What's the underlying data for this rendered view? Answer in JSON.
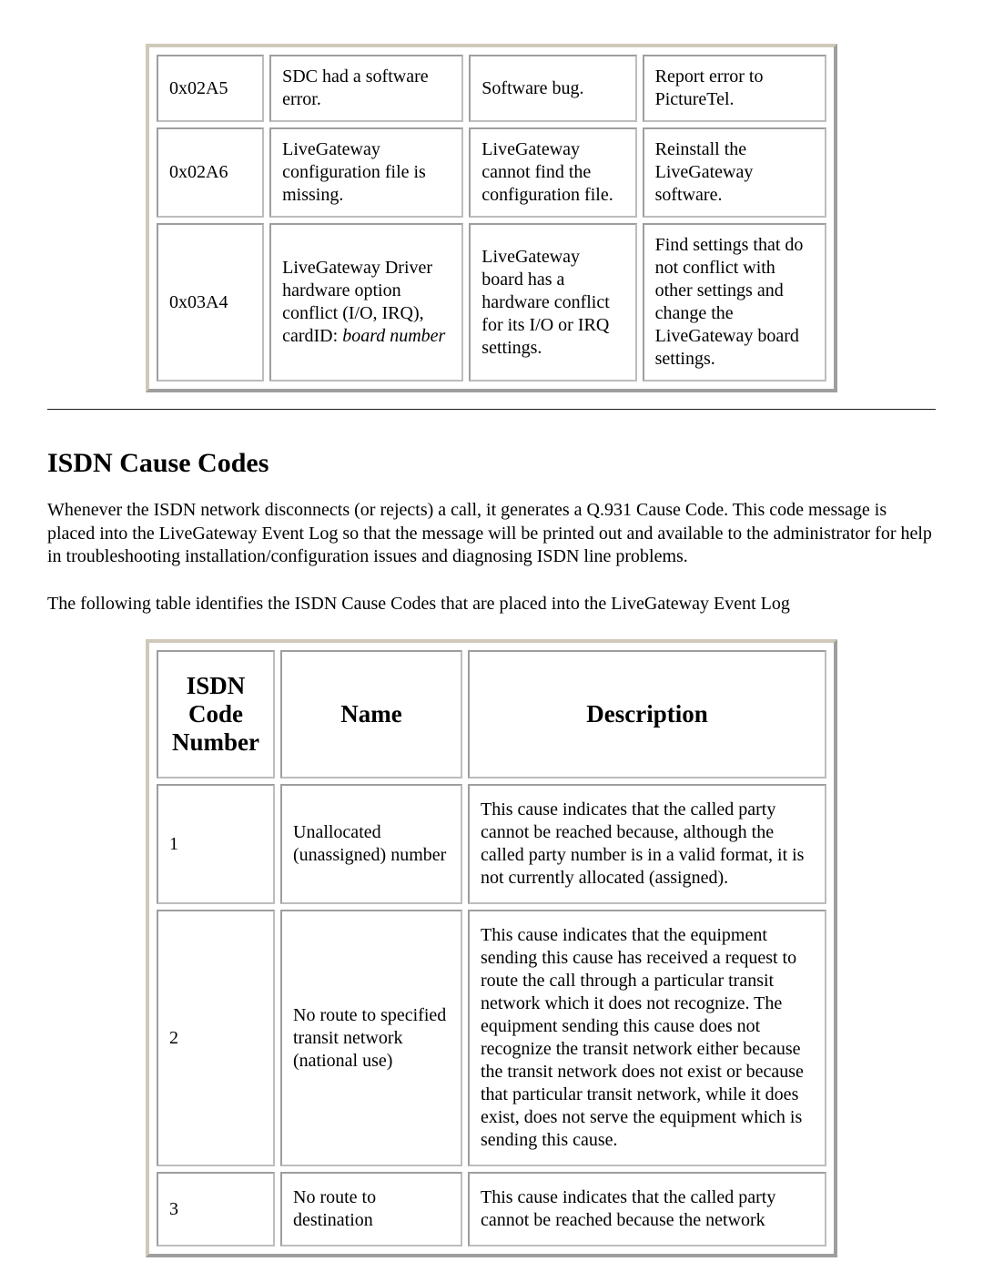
{
  "error_table": {
    "rows": [
      {
        "code": "0x02A5",
        "message": "SDC had a software error.",
        "cause": "Software bug.",
        "action": "Report error to PictureTel."
      },
      {
        "code": "0x02A6",
        "message": "LiveGateway configuration file is missing.",
        "cause": "LiveGateway cannot find the configuration file.",
        "action": "Reinstall the LiveGateway software."
      },
      {
        "code": "0x03A4",
        "message_prefix": "LiveGateway Driver hardware option conflict (I/O, IRQ), cardID: ",
        "message_italic": "board number",
        "cause": "LiveGateway board has a hardware conflict for its I/O or IRQ settings.",
        "action": "Find settings that do not conflict with other settings and change the LiveGateway board settings."
      }
    ]
  },
  "section": {
    "title": "ISDN Cause Codes",
    "para1": "Whenever the ISDN network disconnects (or rejects) a call, it generates a Q.931 Cause Code. This code message is placed into the LiveGateway Event Log so that the message will be printed out and available to the administrator for help in troubleshooting installation/configuration issues and diagnosing ISDN line problems.",
    "para2": "The following table identifies the ISDN Cause Codes that are placed into the LiveGateway Event Log"
  },
  "isdn_table": {
    "headers": {
      "code": "ISDN Code Number",
      "name": "Name",
      "desc": "Description"
    },
    "rows": [
      {
        "code": "1",
        "name": "Unallocated (unassigned) number",
        "desc": "This cause indicates that the called party cannot be reached because, although the called party number is in a valid format, it is not currently allocated (assigned)."
      },
      {
        "code": "2",
        "name": "No route to specified transit network (national use)",
        "desc": "This cause indicates that the equipment sending this cause has received a request to route the call through a particular transit network which it does not recognize. The equipment sending this cause does not recognize the transit network either because the transit network does not exist or because that particular transit network, while it does exist, does not serve the equipment which is sending this cause."
      },
      {
        "code": "3",
        "name": "No route to destination",
        "desc": "This cause indicates that the called party cannot be reached because the network"
      }
    ]
  }
}
